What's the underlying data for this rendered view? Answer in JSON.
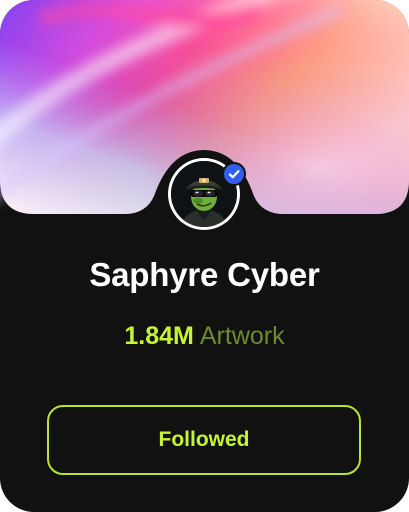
{
  "profile": {
    "name": "Saphyre Cyber",
    "stat_value": "1.84M",
    "stat_label": "Artwork",
    "avatar_icon": "profile-avatar",
    "verified_icon": "verified-check-icon"
  },
  "actions": {
    "follow_label": "Followed"
  },
  "colors": {
    "card_background": "#111111",
    "accent_lime": "#c6f432",
    "muted_lime": "#6e8a2a",
    "verified_blue": "#2f5ef0"
  }
}
